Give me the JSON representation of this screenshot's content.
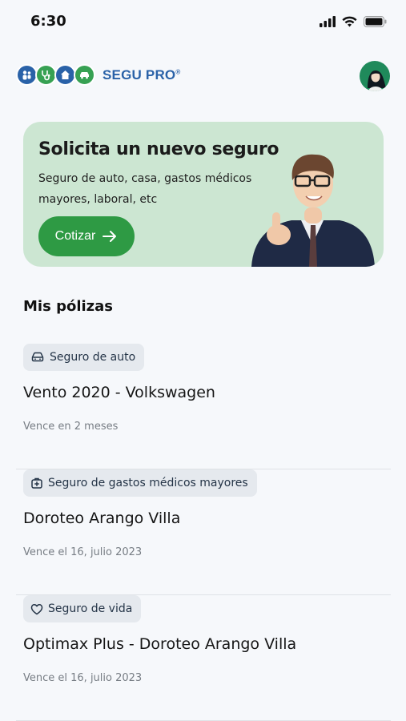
{
  "status": {
    "time": "6:30"
  },
  "brand": {
    "name": "SEGU PRO",
    "mark": "®"
  },
  "promo": {
    "title": "Solicita un nuevo seguro",
    "subtitle": "Seguro de auto, casa, gastos médicos mayores, laboral, etc",
    "cta_label": "Cotizar",
    "cta_icon": "arrow-right-icon"
  },
  "section": {
    "title": "Mis pólizas"
  },
  "policies": [
    {
      "tag": "Seguro de auto",
      "icon": "car-icon",
      "name": "Vento 2020 - Volkswagen",
      "expires": "Vence en 2 meses"
    },
    {
      "tag": "Seguro de gastos médicos mayores",
      "icon": "medical-kit-icon",
      "name": "Doroteo Arango Villa",
      "expires": "Vence el 16, julio 2023"
    },
    {
      "tag": "Seguro de vida",
      "icon": "heart-icon",
      "name": "Optimax Plus - Doroteo Arango Villa",
      "expires": "Vence el 16, julio 2023"
    }
  ],
  "colors": {
    "primary_green": "#2e9a44",
    "promo_bg": "#cce6d2",
    "brand_blue": "#2a62a8",
    "tag_bg": "#e5e9ee",
    "page_bg": "#f6f8fb"
  }
}
